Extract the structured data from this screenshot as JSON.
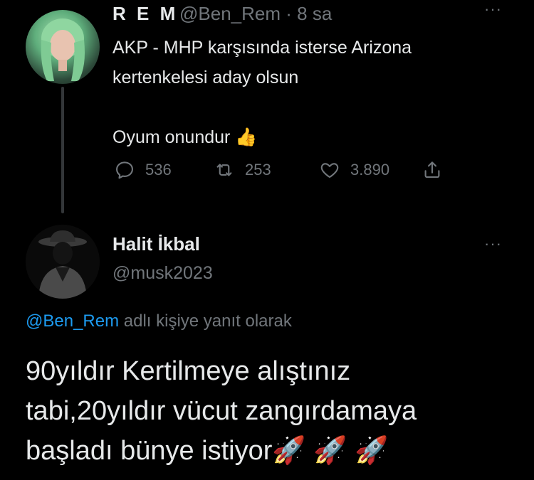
{
  "parent_tweet": {
    "display_name": "R E M",
    "handle": "@Ben_Rem",
    "separator": "·",
    "time": "8 sa",
    "more_label": "···",
    "text": "AKP - MHP karşısında isterse Arizona\nkertenkelesi aday olsun\n\nOyum onundur 👍",
    "counts": {
      "replies": "536",
      "retweets": "253",
      "likes": "3.890"
    }
  },
  "reply_tweet": {
    "display_name": "Halit İkbal",
    "handle": "@musk2023",
    "more_label": "···",
    "replying_to_mention": "@Ben_Rem",
    "replying_to_suffix": " adlı kişiye yanıt olarak",
    "text": "90yıldır Kertilmeye alıştınız\ntabi,20yıldır vücut zangırdamaya\nbaşladı bünye istiyor🚀 🚀 🚀"
  },
  "colors": {
    "background": "#000000",
    "text_primary": "#e7e9ea",
    "text_secondary": "#71767b",
    "accent": "#1d9bf0",
    "thread_line": "#333639"
  },
  "icons": [
    "reply-icon",
    "retweet-icon",
    "like-icon",
    "share-icon",
    "more-icon"
  ]
}
